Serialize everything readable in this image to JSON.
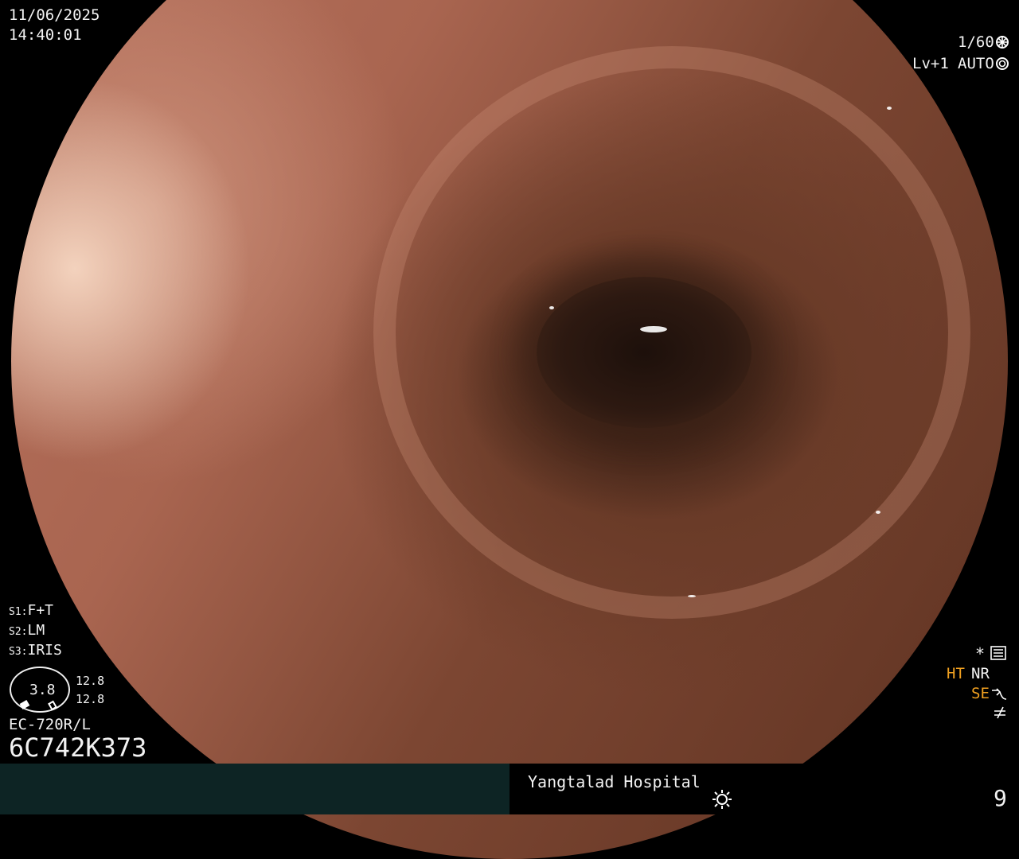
{
  "overlay": {
    "date": "11/06/2025",
    "time": "14:40:01",
    "shutter": "1/60",
    "level": "Lv+1",
    "auto_mode": "AUTO",
    "settings": {
      "s1": "F+T",
      "s2": "LM",
      "s3": "IRIS"
    },
    "gauge_value": "3.8",
    "side_values": [
      "12.8",
      "12.8"
    ],
    "scope_model": "EC-720R/L",
    "scope_serial": "6C742K373",
    "star": "*",
    "ht": "HT",
    "nr": "NR",
    "se": "SE",
    "hospital": "Yangtalad Hospital",
    "image_number": "9"
  },
  "colors": {
    "orange_text": "#f0a020",
    "footer_left": "#0d2424",
    "background": "#000000"
  },
  "icons": [
    "shutter-icon",
    "auto-iris-icon",
    "settings-grid-icon",
    "curve-icon",
    "not-equal-icon",
    "sun-icon"
  ]
}
